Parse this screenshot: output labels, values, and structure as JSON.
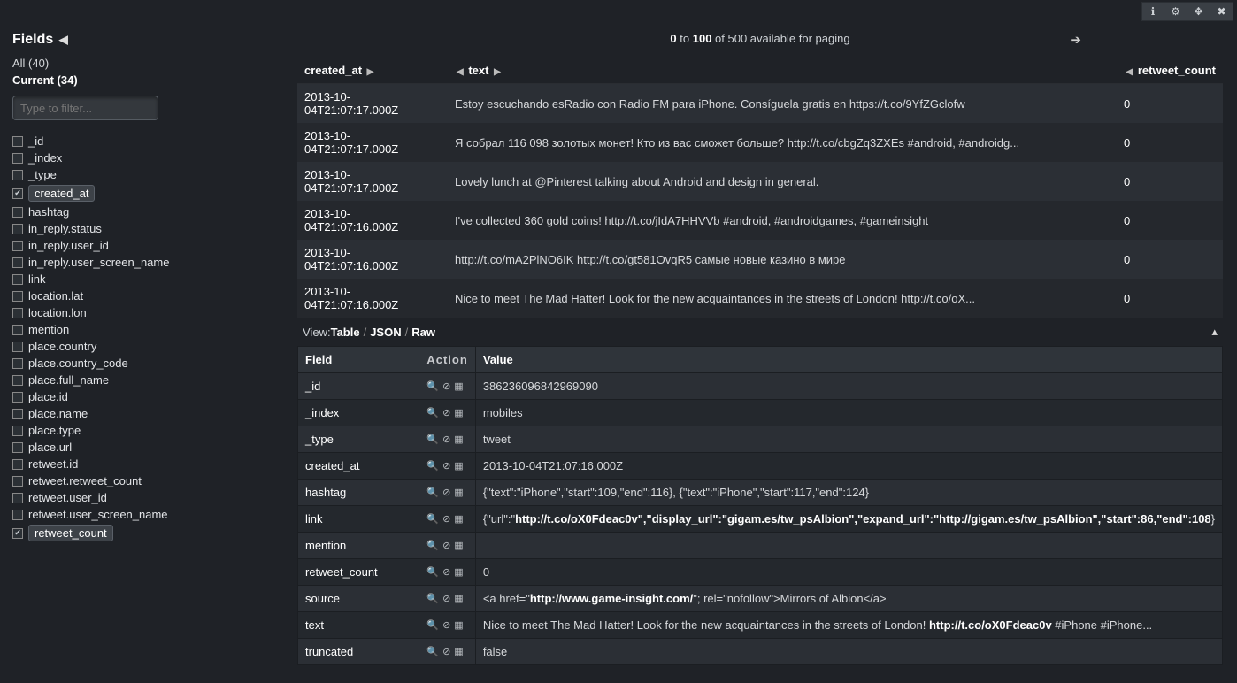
{
  "toolbar": {
    "info": "ℹ",
    "gear": "⚙",
    "move": "✥",
    "close": "✖"
  },
  "sidebar": {
    "title": "Fields",
    "all": "All (40)",
    "current": "Current (34)",
    "filter_placeholder": "Type to filter...",
    "fields": [
      {
        "name": "_id",
        "checked": false
      },
      {
        "name": "_index",
        "checked": false
      },
      {
        "name": "_type",
        "checked": false
      },
      {
        "name": "created_at",
        "checked": true
      },
      {
        "name": "hashtag",
        "checked": false
      },
      {
        "name": "in_reply.status",
        "checked": false
      },
      {
        "name": "in_reply.user_id",
        "checked": false
      },
      {
        "name": "in_reply.user_screen_name",
        "checked": false
      },
      {
        "name": "link",
        "checked": false
      },
      {
        "name": "location.lat",
        "checked": false
      },
      {
        "name": "location.lon",
        "checked": false
      },
      {
        "name": "mention",
        "checked": false
      },
      {
        "name": "place.country",
        "checked": false
      },
      {
        "name": "place.country_code",
        "checked": false
      },
      {
        "name": "place.full_name",
        "checked": false
      },
      {
        "name": "place.id",
        "checked": false
      },
      {
        "name": "place.name",
        "checked": false
      },
      {
        "name": "place.type",
        "checked": false
      },
      {
        "name": "place.url",
        "checked": false
      },
      {
        "name": "retweet.id",
        "checked": false
      },
      {
        "name": "retweet.retweet_count",
        "checked": false
      },
      {
        "name": "retweet.user_id",
        "checked": false
      },
      {
        "name": "retweet.user_screen_name",
        "checked": false
      },
      {
        "name": "retweet_count",
        "checked": true
      }
    ]
  },
  "pager": {
    "from": "0",
    "to": "100",
    "of": " of 500 available for paging",
    "to_lbl": " to "
  },
  "columns": {
    "created_at": "created_at",
    "text": "text",
    "retweet_count": "retweet_count"
  },
  "rows": [
    {
      "created_at": "2013-10-04T21:07:17.000Z",
      "text": "Estoy escuchando esRadio con Radio FM para iPhone. Consíguela gratis en https://t.co/9YfZGclofw",
      "retweet_count": "0"
    },
    {
      "created_at": "2013-10-04T21:07:17.000Z",
      "text": "Я собрал 116 098 золотых монет! Кто из вас сможет больше? http://t.co/cbgZq3ZXEs #android, #androidg...",
      "retweet_count": "0"
    },
    {
      "created_at": "2013-10-04T21:07:17.000Z",
      "text": "Lovely lunch at @Pinterest talking about Android and design in general.",
      "retweet_count": "0"
    },
    {
      "created_at": "2013-10-04T21:07:16.000Z",
      "text": "I've collected 360 gold coins! http://t.co/jIdA7HHVVb #android, #androidgames, #gameinsight",
      "retweet_count": "0"
    },
    {
      "created_at": "2013-10-04T21:07:16.000Z",
      "text": "http://t.co/mA2PlNO6IK http://t.co/gt581OvqR5 самые новые казино в мире",
      "retweet_count": "0"
    },
    {
      "created_at": "2013-10-04T21:07:16.000Z",
      "text": "Nice to meet The Mad Hatter! Look for the new acquaintances in the streets of London! http://t.co/oX...",
      "retweet_count": "0"
    }
  ],
  "view": {
    "label": "View: ",
    "table": "Table",
    "json": "JSON",
    "raw": "Raw"
  },
  "detail_headers": {
    "field": "Field",
    "action": "Action",
    "value": "Value"
  },
  "detail": [
    {
      "field": "_id",
      "value": "386236096842969090"
    },
    {
      "field": "_index",
      "value": "mobiles"
    },
    {
      "field": "_type",
      "value": "tweet"
    },
    {
      "field": "created_at",
      "value": "2013-10-04T21:07:16.000Z"
    },
    {
      "field": "hashtag",
      "value": "{\"text\":\"iPhone\",\"start\":109,\"end\":116}, {\"text\":\"iPhone\",\"start\":117,\"end\":124}"
    },
    {
      "field": "link",
      "value_pre": "{\"url\":\"",
      "value_hl": "http://t.co/oX0Fdeac0v\",\"display_url\":\"gigam.es/tw_psAlbion\",\"expand_url\":\"http://gigam.es/tw_psAlbion\",\"start\":86,\"end\":108",
      "value_post": "}"
    },
    {
      "field": "mention",
      "value": ""
    },
    {
      "field": "retweet_count",
      "value": "0"
    },
    {
      "field": "source",
      "value_pre": "<a href=\"",
      "value_hl": "http://www.game-insight.com/",
      "value_post": "\"; rel=\"nofollow\">Mirrors of Albion</a>"
    },
    {
      "field": "text",
      "value_pre": "Nice to meet The Mad Hatter! Look for the new acquaintances in the streets of London! ",
      "value_hl": "http://t.co/oX0Fdeac0v",
      "value_post": " #iPhone #iPhone..."
    },
    {
      "field": "truncated",
      "value": "false"
    }
  ]
}
